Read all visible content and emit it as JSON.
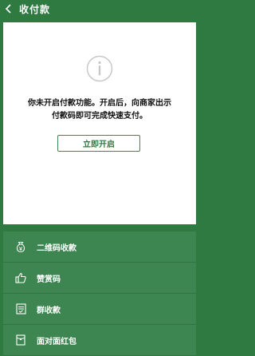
{
  "header": {
    "title": "收付款"
  },
  "card": {
    "message_line1": "你未开启付款功能。开启后，向商家出示",
    "message_line2": "付款码即可完成快速支付。",
    "activate_label": "立即开启"
  },
  "menu": {
    "items": [
      {
        "label": "二维码收款",
        "icon": "money-bag-icon"
      },
      {
        "label": "赞赏码",
        "icon": "thumbs-up-icon"
      },
      {
        "label": "群收款",
        "icon": "checklist-icon"
      },
      {
        "label": "面对面红包",
        "icon": "red-packet-icon"
      }
    ]
  },
  "colors": {
    "background": "#2e7a41",
    "menu": "#3d8651",
    "card": "#ffffff"
  }
}
